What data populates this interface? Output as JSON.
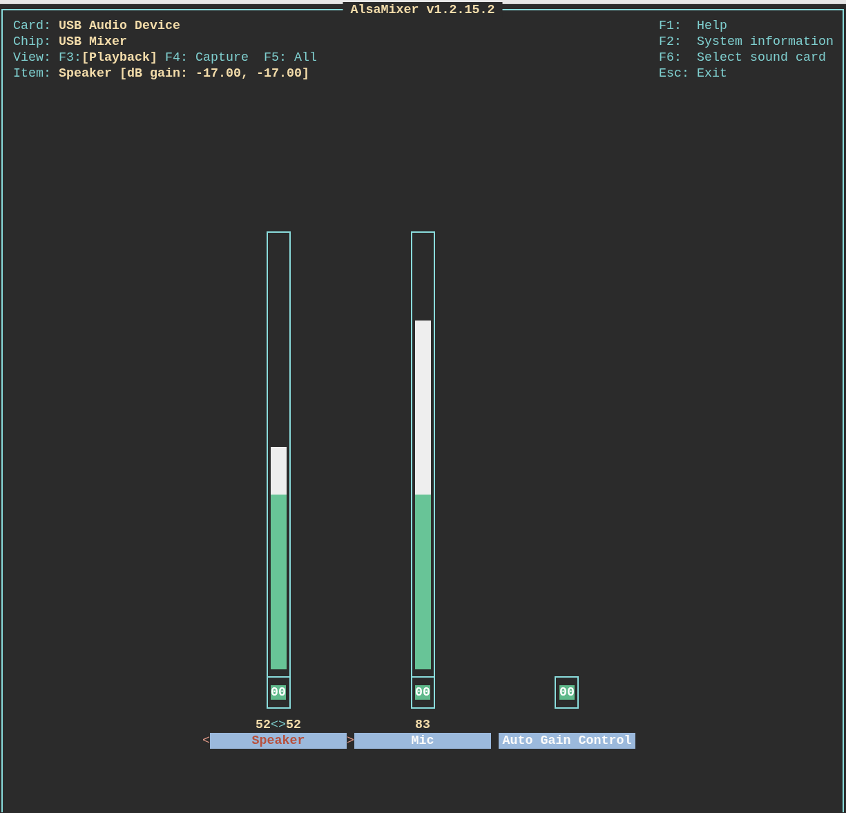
{
  "window": {
    "title": "AlsaMixer v1.2.15.2"
  },
  "card": {
    "label": "Card:",
    "value": "USB Audio Device"
  },
  "chip": {
    "label": "Chip:",
    "value": "USB Mixer"
  },
  "view": {
    "label": "View:",
    "bracket_open": "[",
    "bracket_close": "]",
    "modes": [
      {
        "key": "F3:",
        "name": "Playback",
        "selected": true
      },
      {
        "key": "F4:",
        "name": "Capture",
        "selected": false
      },
      {
        "key": "F5:",
        "name": "All",
        "selected": false
      }
    ]
  },
  "item": {
    "label": "Item:",
    "value": "Speaker [dB gain: -17.00, -17.00]"
  },
  "shortcuts": [
    {
      "key": "F1:",
      "action": "Help"
    },
    {
      "key": "F2:",
      "action": "System information"
    },
    {
      "key": "F6:",
      "action": "Select sound card"
    },
    {
      "key": "Esc:",
      "action": "Exit"
    }
  ],
  "selection_marks": [
    "<",
    ">"
  ],
  "channels": [
    {
      "kind": "volume",
      "name": "Speaker",
      "selected": true,
      "level": 0.51,
      "readings": [
        "52",
        "52"
      ],
      "joiner": "<>",
      "switch": "00",
      "muted": false
    },
    {
      "kind": "volume",
      "name": "Mic",
      "selected": false,
      "level": 0.8,
      "readings": [
        "83"
      ],
      "switch": "00",
      "muted": false
    },
    {
      "kind": "switch",
      "name": "Auto Gain Control",
      "selected": false,
      "switch": "00",
      "muted": false
    }
  ]
}
